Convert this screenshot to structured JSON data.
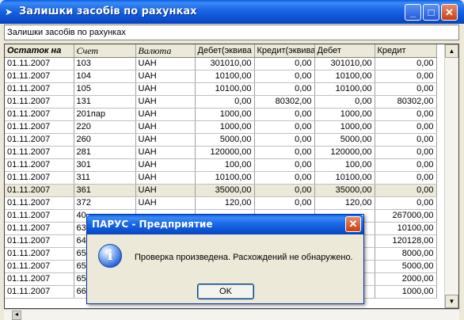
{
  "window": {
    "title": "Залишки засобів по рахунках",
    "subheader": "Залишки засобів по рахунках",
    "buttons": {
      "minimize": "_",
      "maximize": "□",
      "close": "✕"
    }
  },
  "table": {
    "columns": [
      "Остаток на",
      "Счет",
      "Валюта",
      "Дебет(эквива",
      "Кредит(эквива",
      "Дебет",
      "Кредит"
    ],
    "rows": [
      [
        "01.11.2007",
        "103",
        "UAH",
        "301010,00",
        "0,00",
        "301010,00",
        "0,00"
      ],
      [
        "01.11.2007",
        "104",
        "UAH",
        "10100,00",
        "0,00",
        "10100,00",
        "0,00"
      ],
      [
        "01.11.2007",
        "105",
        "UAH",
        "10100,00",
        "0,00",
        "10100,00",
        "0,00"
      ],
      [
        "01.11.2007",
        "131",
        "UAH",
        "0,00",
        "80302,00",
        "0,00",
        "80302,00"
      ],
      [
        "01.11.2007",
        "201пар",
        "UAH",
        "1000,00",
        "0,00",
        "1000,00",
        "0,00"
      ],
      [
        "01.11.2007",
        "220",
        "UAH",
        "1000,00",
        "0,00",
        "1000,00",
        "0,00"
      ],
      [
        "01.11.2007",
        "260",
        "UAH",
        "5000,00",
        "0,00",
        "5000,00",
        "0,00"
      ],
      [
        "01.11.2007",
        "281",
        "UAH",
        "120000,00",
        "0,00",
        "120000,00",
        "0,00"
      ],
      [
        "01.11.2007",
        "301",
        "UAH",
        "100,00",
        "0,00",
        "100,00",
        "0,00"
      ],
      [
        "01.11.2007",
        "311",
        "UAH",
        "10100,00",
        "0,00",
        "10100,00",
        "0,00"
      ],
      [
        "01.11.2007",
        "361",
        "UAH",
        "35000,00",
        "0,00",
        "35000,00",
        "0,00"
      ],
      [
        "01.11.2007",
        "372",
        "UAH",
        "120,00",
        "0,00",
        "120,00",
        "0,00"
      ],
      [
        "01.11.2007",
        "40",
        "",
        "",
        "",
        "",
        "267000,00"
      ],
      [
        "01.11.2007",
        "63",
        "",
        "",
        "",
        "",
        "10100,00"
      ],
      [
        "01.11.2007",
        "64",
        "",
        "",
        "",
        "",
        "120128,00"
      ],
      [
        "01.11.2007",
        "65",
        "",
        "",
        "",
        "",
        "8000,00"
      ],
      [
        "01.11.2007",
        "65",
        "",
        "",
        "",
        "",
        "5000,00"
      ],
      [
        "01.11.2007",
        "65",
        "",
        "",
        "",
        "",
        "2000,00"
      ],
      [
        "01.11.2007",
        "66",
        "",
        "",
        "",
        "",
        "1000,00"
      ]
    ],
    "selected_row": 10
  },
  "dialog": {
    "title": "ПАРУС - Предприятие",
    "message": "Проверка произведена. Расхождений не обнаружено.",
    "ok_label": "OK",
    "icon": "info-icon",
    "icon_glyph": "i",
    "close_glyph": "✕"
  },
  "scrollbar": {
    "up": "▲",
    "down": "▼",
    "left": "◄"
  }
}
